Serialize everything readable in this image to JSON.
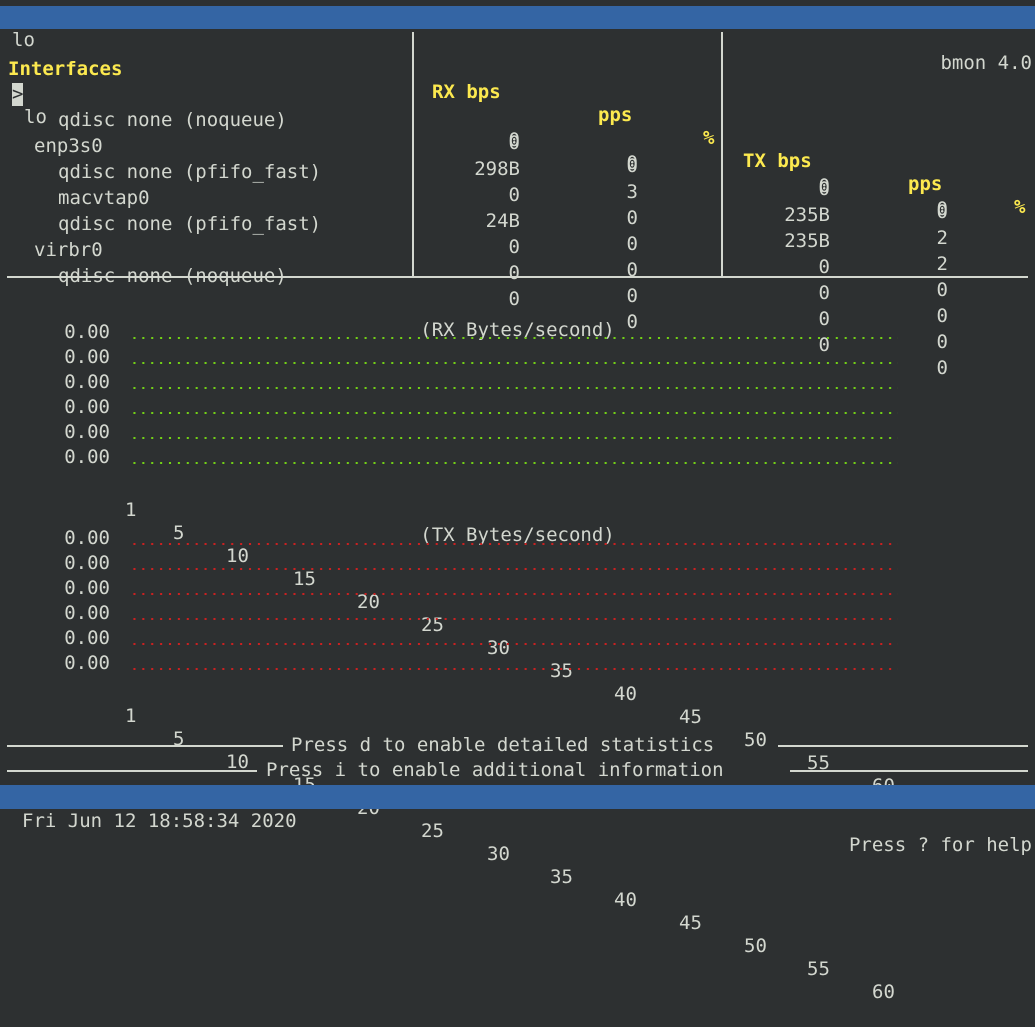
{
  "titlebar": {
    "left": "lo",
    "right": "bmon 4.0"
  },
  "header": {
    "interfaces": "Interfaces",
    "rx_bps": "RX bps",
    "rx_pps": "pps",
    "rx_pct": "%",
    "tx_bps": "TX bps",
    "tx_pps": "pps",
    "tx_pct": "%"
  },
  "cursor": ">",
  "rows": [
    {
      "name": "lo",
      "rx_bps": "0",
      "rx_pps": "0",
      "tx_bps": "0",
      "tx_pps": "0"
    },
    {
      "name": "qdisc none (noqueue)",
      "rx_bps": "0",
      "rx_pps": "0",
      "tx_bps": "0",
      "tx_pps": "0"
    },
    {
      "name": "enp3s0",
      "rx_bps": "298B",
      "rx_pps": "3",
      "tx_bps": "235B",
      "tx_pps": "2"
    },
    {
      "name": "qdisc none (pfifo_fast)",
      "rx_bps": "0",
      "rx_pps": "0",
      "tx_bps": "235B",
      "tx_pps": "2"
    },
    {
      "name": "macvtap0",
      "rx_bps": "24B",
      "rx_pps": "0",
      "tx_bps": "0",
      "tx_pps": "0"
    },
    {
      "name": "qdisc none (pfifo_fast)",
      "rx_bps": "0",
      "rx_pps": "0",
      "tx_bps": "0",
      "tx_pps": "0"
    },
    {
      "name": "virbr0",
      "rx_bps": "0",
      "rx_pps": "0",
      "tx_bps": "0",
      "tx_pps": "0"
    },
    {
      "name": "qdisc none (noqueue)",
      "rx_bps": "0",
      "rx_pps": "0",
      "tx_bps": "0",
      "tx_pps": "0"
    }
  ],
  "chart_data": [
    {
      "type": "line",
      "title": "(RX Bytes/second)",
      "y_tick_labels": [
        "0.00",
        "0.00",
        "0.00",
        "0.00",
        "0.00",
        "0.00"
      ],
      "x_tick_labels": [
        "1",
        "5",
        "10",
        "15",
        "20",
        "25",
        "30",
        "35",
        "40",
        "45",
        "50",
        "55",
        "60"
      ],
      "color": "#73d216",
      "series": [
        {
          "values": [
            0,
            0,
            0,
            0,
            0,
            0,
            0,
            0,
            0,
            0,
            0,
            0,
            0
          ]
        }
      ]
    },
    {
      "type": "line",
      "title": "(TX Bytes/second)",
      "y_tick_labels": [
        "0.00",
        "0.00",
        "0.00",
        "0.00",
        "0.00",
        "0.00"
      ],
      "x_tick_labels": [
        "1",
        "5",
        "10",
        "15",
        "20",
        "25",
        "30",
        "35",
        "40",
        "45",
        "50",
        "55",
        "60"
      ],
      "color": "#cc0000",
      "series": [
        {
          "values": [
            0,
            0,
            0,
            0,
            0,
            0,
            0,
            0,
            0,
            0,
            0,
            0,
            0
          ]
        }
      ]
    }
  ],
  "hints": {
    "detailed": "Press d to enable detailed statistics",
    "info": "Press i to enable additional information"
  },
  "statusbar": {
    "datetime": "Fri Jun 12 18:58:34 2020",
    "help": "Press ? for help"
  }
}
